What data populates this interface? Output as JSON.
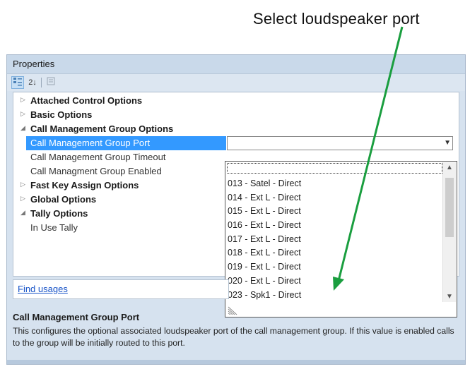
{
  "annotation": {
    "text": "Select loudspeaker port",
    "arrow_color": "#1a9e3f"
  },
  "panel": {
    "title": "Properties",
    "toolbar": {
      "categorized_icon": "categorized-icon",
      "alphabetical_icon": "sort-az-icon",
      "pages_icon": "property-pages-icon",
      "alphabetical_glyph": "2↓"
    }
  },
  "grid": {
    "rows": [
      {
        "type": "category",
        "expanded": false,
        "label": "Attached Control Options"
      },
      {
        "type": "category",
        "expanded": false,
        "label": "Basic Options"
      },
      {
        "type": "category",
        "expanded": true,
        "label": "Call Management Group Options"
      },
      {
        "type": "property",
        "selected": true,
        "label": "Call Management Group Port"
      },
      {
        "type": "property",
        "label": "Call Management Group Timeout"
      },
      {
        "type": "property",
        "label": "Call Managment Group Enabled"
      },
      {
        "type": "category",
        "expanded": false,
        "label": "Fast Key Assign Options"
      },
      {
        "type": "category",
        "expanded": false,
        "label": "Global Options"
      },
      {
        "type": "category",
        "expanded": true,
        "label": "Tally Options"
      },
      {
        "type": "property",
        "label": "In Use Tally"
      }
    ],
    "collapsed_glyph": "▷",
    "expanded_glyph": "◢",
    "selected_color": "#3399ff"
  },
  "dropdown": {
    "input_value": "",
    "items": [
      "013 - Satel - Direct",
      "014 - Ext L - Direct",
      "015 - Ext L - Direct",
      "016 - Ext L - Direct",
      "017 - Ext L - Direct",
      "018 - Ext L - Direct",
      "019 - Ext L - Direct",
      "020 - Ext L - Direct",
      "023 - Spk1 - Direct"
    ]
  },
  "links": {
    "find_usages": "Find usages"
  },
  "description": {
    "title": "Call Management Group Port",
    "body": "This configures the optional associated loudspeaker port of the call management group. If this value is enabled calls to the group will be initially routed to this port."
  }
}
